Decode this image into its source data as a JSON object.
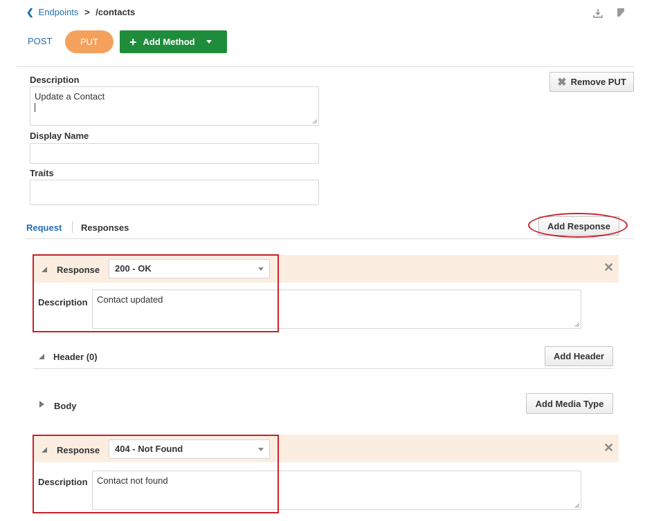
{
  "breadcrumb": {
    "parent": "Endpoints",
    "separator": ">",
    "current": "/contacts"
  },
  "toolbar": {
    "download_icon": "download-icon",
    "edit_icon": "edit-icon"
  },
  "methods": {
    "post_label": "POST",
    "put_label": "PUT",
    "add_method_label": "Add Method",
    "active": "PUT"
  },
  "form": {
    "description_label": "Description",
    "description_value": "Update a Contact",
    "display_name_label": "Display Name",
    "display_name_value": "",
    "traits_label": "Traits",
    "traits_value": "",
    "remove_label": "Remove PUT"
  },
  "tabs": {
    "request_label": "Request",
    "responses_label": "Responses",
    "add_response_label": "Add Response"
  },
  "responses": [
    {
      "label": "Response",
      "status": "200 - OK",
      "description_label": "Description",
      "description_value": "Contact updated"
    },
    {
      "label": "Response",
      "status": "404 - Not Found",
      "description_label": "Description",
      "description_value": "Contact not found"
    }
  ],
  "header_section": {
    "label": "Header (0)",
    "add_label": "Add Header"
  },
  "body_section": {
    "label": "Body",
    "add_label": "Add Media Type"
  },
  "colors": {
    "accent_blue": "#1f6fb2",
    "put_orange": "#f4a15e",
    "add_method_green": "#1e8c3a",
    "response_header_bg": "#fbeee0",
    "annotation_red": "#c8202a"
  }
}
